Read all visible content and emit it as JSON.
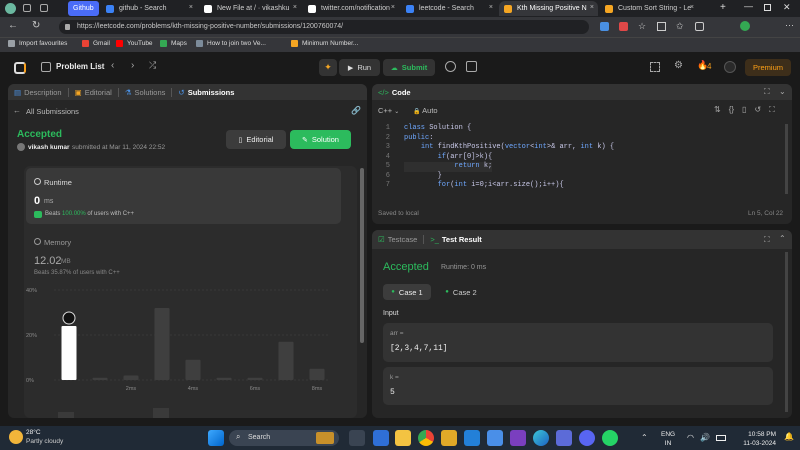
{
  "browser": {
    "tabs": [
      {
        "label": "Github",
        "color": "#4a6cf7"
      },
      {
        "label": "github - Search",
        "color": "#3b82f6"
      },
      {
        "label": "New File at / · vikashku",
        "color": "#ffffff"
      },
      {
        "label": "twitter.com/notification",
        "color": "#ffffff"
      },
      {
        "label": "leetcode - Search",
        "color": "#3b82f6"
      },
      {
        "label": "Kth Missing Positive N",
        "color": "#f5a623"
      },
      {
        "label": "Custom Sort String - Le",
        "color": "#f5a623"
      }
    ],
    "url": "https://leetcode.com/problems/kth-missing-positive-number/submissions/1200760074/",
    "bookmarks": [
      {
        "label": "Import favourites",
        "color": "#9aa0a6"
      },
      {
        "label": "Gmail",
        "color": "#ea4335"
      },
      {
        "label": "YouTube",
        "color": "#ff0000"
      },
      {
        "label": "Maps",
        "color": "#34a853"
      },
      {
        "label": "How to join two Ve...",
        "color": "#7c8b9a"
      },
      {
        "label": "Minimum Number...",
        "color": "#f5a623"
      }
    ]
  },
  "nav": {
    "problem_list": "Problem List",
    "run": "Run",
    "submit": "Submit",
    "streak": "4",
    "premium": "Premium"
  },
  "left": {
    "tabs": [
      "Description",
      "Editorial",
      "Solutions",
      "Submissions"
    ],
    "back": "All Submissions",
    "status": "Accepted",
    "user": "vikash kumar",
    "submitted": "submitted at Mar 11, 2024 22:52",
    "editorial_btn": "Editorial",
    "solution_btn": "Solution",
    "runtime": {
      "title": "Runtime",
      "value": "0",
      "unit": "ms",
      "beats": "Beats",
      "pct": "100.00%",
      "of": "of users with C++"
    },
    "memory": {
      "title": "Memory",
      "value": "12.02",
      "unit": "MB",
      "beats": "Beats 35.87% of users with C++"
    },
    "chart": {
      "y_ticks": [
        "40%",
        "20%",
        "0%"
      ],
      "x_ticks": [
        "2ms",
        "4ms",
        "6ms",
        "8ms"
      ]
    }
  },
  "chart_data": {
    "type": "bar",
    "categories": [
      "0ms",
      "1ms",
      "2ms",
      "3ms",
      "4ms",
      "5ms",
      "6ms",
      "7ms",
      "8ms"
    ],
    "values": [
      24,
      1,
      2,
      32,
      9,
      1,
      1,
      17,
      5
    ],
    "ylim": [
      0,
      40
    ],
    "highlight_index": 0,
    "xlabel": "",
    "ylabel": ""
  },
  "code": {
    "tab": "Code",
    "lang": "C++",
    "mode": "Auto",
    "lines": [
      "class Solution {",
      "public:",
      "    int findKthPositive(vector<int>& arr, int k) {",
      "        if(arr[0]>k){",
      "            return k;",
      "        }",
      "        for(int i=0;i<arr.size();i++){"
    ],
    "saved": "Saved to local",
    "position": "Ln 5, Col 22"
  },
  "test": {
    "tab_testcase": "Testcase",
    "tab_result": "Test Result",
    "status": "Accepted",
    "runtime": "Runtime: 0 ms",
    "case1": "Case 1",
    "case2": "Case 2",
    "input_label": "Input",
    "arr_label": "arr =",
    "arr_value": "[2,3,4,7,11]",
    "k_label": "k =",
    "k_value": "5"
  },
  "taskbar": {
    "temp": "28°C",
    "weather": "Partly cloudy",
    "search": "Search",
    "lang1": "ENG",
    "lang2": "IN",
    "time": "10:58 PM",
    "date": "11-03-2024"
  }
}
